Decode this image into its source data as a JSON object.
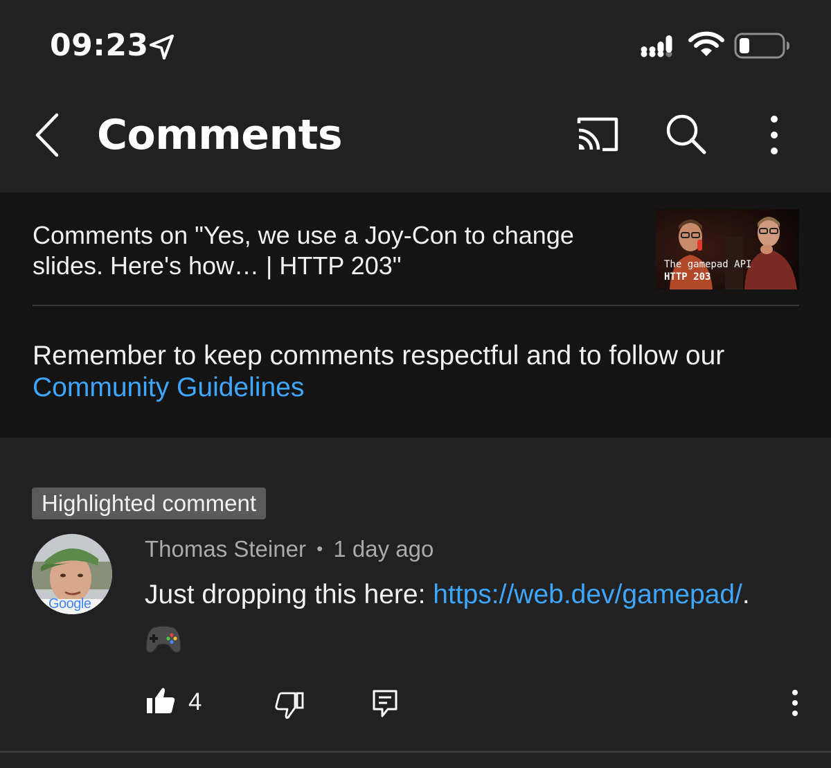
{
  "status_bar": {
    "time": "09:23"
  },
  "app_bar": {
    "title": "Comments"
  },
  "header": {
    "video_caption": "Comments on \"Yes, we use a Joy-Con to change slides. Here's how… | HTTP 203\"",
    "thumbnail_text_line1": "The gamepad API",
    "thumbnail_text_line2": "HTTP 203",
    "guidelines_text": "Remember to keep comments respectful and to follow our",
    "guidelines_link": "Community Guidelines"
  },
  "comment": {
    "badge": "Highlighted comment",
    "author": "Thomas Steiner",
    "separator": "•",
    "time": "1 day ago",
    "text_prefix": "Just dropping this here: ",
    "link": "https://web.dev/gamepad/",
    "text_suffix": ".",
    "avatar_logo_text": "Google",
    "like_count": "4"
  },
  "colors": {
    "background": "#212121",
    "header_panel": "#141414",
    "link": "#3ea6ff",
    "secondary_text": "#aaaaaa"
  },
  "icons": [
    "location-arrow-icon",
    "cellular-signal-icon",
    "wifi-icon",
    "battery-icon",
    "back-chevron-icon",
    "cast-icon",
    "search-icon",
    "more-vert-icon",
    "gamepad-icon",
    "thumbs-up-icon",
    "thumbs-down-icon",
    "reply-icon"
  ]
}
